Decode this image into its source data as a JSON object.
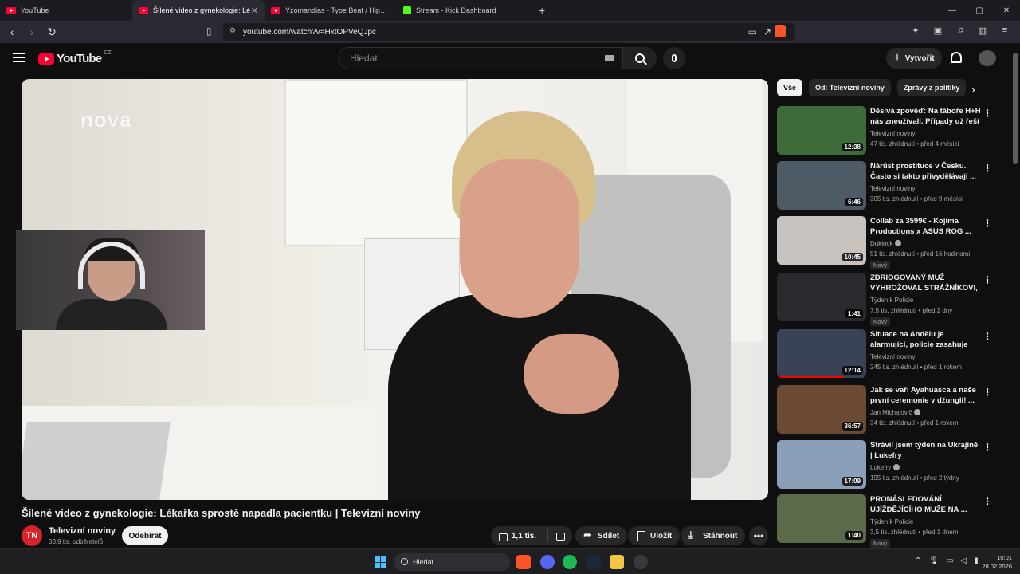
{
  "browser": {
    "tabs": [
      {
        "label": "YouTube",
        "icon": "youtube-icon",
        "active": false
      },
      {
        "label": "Šílené video z gynekologie: Lé",
        "icon": "youtube-icon",
        "active": true
      },
      {
        "label": "Yzomandias - Type Beat / Hip Thrust",
        "icon": "youtube-icon",
        "active": false
      },
      {
        "label": "Stream - Kick Dashboard",
        "icon": "kick-icon",
        "active": false
      }
    ],
    "new_tab": "+",
    "url": "youtube.com/watch?v=HxtOPVeQJpc",
    "window_controls": [
      "—",
      "▢",
      "✕"
    ]
  },
  "youtube": {
    "logo_word": "YouTube",
    "country": "CZ",
    "search_placeholder": "Hledat",
    "create_label": "Vytvořit",
    "create_icon": "+"
  },
  "video": {
    "overlay_logo": "nova",
    "title": "Šílené video z gynekologie: Lékařka sprostě napadla pacientku | Televizní noviny",
    "channel": "Televizní noviny",
    "channel_initials": "TN",
    "subscribers": "33,9 tis. odběratelů",
    "subscribe_label": "Odebírat",
    "likes": "1,1 tis.",
    "share_label": "Sdílet",
    "save_label": "Uložit",
    "download_label": "Stáhnout",
    "more_label": "•••"
  },
  "chips": [
    "Vše",
    "Od: Televizní noviny",
    "Zprávy z politiky"
  ],
  "recommendations": [
    {
      "title": "Děsivá zpověď: Na táboře H+H nás zneužívali. Případy už řeší ...",
      "channel": "Televizní noviny",
      "verified": false,
      "meta": "47 tis. zhlédnutí • před 4 měsíci",
      "duration": "12:38",
      "badge": "",
      "thumb_color": "#3d6b3a",
      "progress": 0.0
    },
    {
      "title": "Nárůst prostituce v Česku. Často si takto přivydělávají ...",
      "channel": "Televizní noviny",
      "verified": false,
      "meta": "305 tis. zhlédnutí • před 9 měsíci",
      "duration": "6:46",
      "badge": "",
      "thumb_color": "#4d5b66",
      "progress": 0.0
    },
    {
      "title": "Collab za 3599€ - Kojima Productions x ASUS ROG ...",
      "channel": "Duklock",
      "verified": true,
      "meta": "51 tis. zhlédnutí • před 16 hodinami",
      "duration": "10:45",
      "badge": "Nový",
      "thumb_color": "#c9c3c0",
      "progress": 0.0
    },
    {
      "title": "ZDRIOGOVANÝ MUŽ VYHROŽOVAL STRÁŽNÍKOVI, ...",
      "channel": "Týdeník Policie",
      "verified": false,
      "meta": "7,5 tis. zhlédnutí • před 2 dny",
      "duration": "1:41",
      "badge": "Nový",
      "thumb_color": "#2a2a2e",
      "progress": 0.0
    },
    {
      "title": "Situace na Andělu je alarmující, policie zasahuje téměř denně | ...",
      "channel": "Televizní noviny",
      "verified": false,
      "meta": "245 tis. zhlédnutí • před 1 rokem",
      "duration": "12:14",
      "badge": "",
      "thumb_color": "#3a4256",
      "progress": 0.75
    },
    {
      "title": "Jak se vaří Ayahuasca a naše první ceremonie v džungli! ...",
      "channel": "Jan Michalovič",
      "verified": true,
      "meta": "34 tis. zhlédnutí • před 1 rokem",
      "duration": "36:57",
      "badge": "",
      "thumb_color": "#6b4a33",
      "progress": 0.0
    },
    {
      "title": "Strávil jsem týden na Ukrajině | Lukefry",
      "channel": "Lukefry",
      "verified": true,
      "meta": "195 tis. zhlédnutí • před 2 týdny",
      "duration": "17:09",
      "badge": "",
      "thumb_color": "#8aa0b8",
      "progress": 0.0
    },
    {
      "title": "PRONÁSLEDOVÁNÍ UJÍŽDĚJÍCÍHO MUŽE NA ...",
      "channel": "Týdeník Policie",
      "verified": false,
      "meta": "3,5 tis. zhlédnutí • před 1 dnem",
      "duration": "1:40",
      "badge": "Nový",
      "thumb_color": "#5d6a4a",
      "progress": 0.0
    }
  ],
  "taskbar": {
    "search_placeholder": "Hledat",
    "time": "10:01",
    "date": "28.02.2026"
  }
}
